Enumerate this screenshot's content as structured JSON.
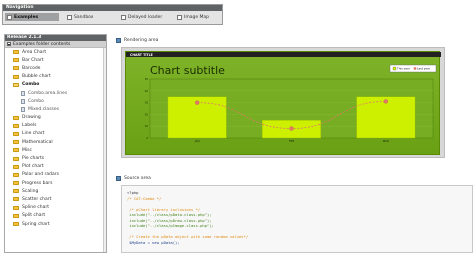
{
  "navigation": {
    "title": "Navigation",
    "tabs": [
      {
        "label": "Examples",
        "active": true
      },
      {
        "label": "Sandbox"
      },
      {
        "label": "Delayed loader"
      },
      {
        "label": "Image Map"
      }
    ]
  },
  "sidebar": {
    "release": "Release 2.1.3",
    "contents_label": "Examples folder contents",
    "items": [
      {
        "label": "Area Chart",
        "kind": "folder"
      },
      {
        "label": "Bar Chart",
        "kind": "folder"
      },
      {
        "label": "Barcode",
        "kind": "folder"
      },
      {
        "label": "Bubble chart",
        "kind": "folder"
      },
      {
        "label": "Combo",
        "kind": "folder-open"
      },
      {
        "label": "Combo.area.lines",
        "kind": "file"
      },
      {
        "label": "Combo",
        "kind": "file"
      },
      {
        "label": "Mixed.classes",
        "kind": "file"
      },
      {
        "label": "Drawing",
        "kind": "folder"
      },
      {
        "label": "Labels",
        "kind": "folder"
      },
      {
        "label": "Line chart",
        "kind": "folder"
      },
      {
        "label": "Mathematical",
        "kind": "folder"
      },
      {
        "label": "Misc",
        "kind": "folder"
      },
      {
        "label": "Pie charts",
        "kind": "folder"
      },
      {
        "label": "Plot chart",
        "kind": "folder"
      },
      {
        "label": "Polar and radars",
        "kind": "folder"
      },
      {
        "label": "Progress bars",
        "kind": "folder"
      },
      {
        "label": "Scaling",
        "kind": "folder"
      },
      {
        "label": "Scatter chart",
        "kind": "folder"
      },
      {
        "label": "Spline chart",
        "kind": "folder"
      },
      {
        "label": "Split chart",
        "kind": "folder"
      },
      {
        "label": "Spring chart",
        "kind": "folder"
      }
    ]
  },
  "rendering": {
    "title": "Rendering area",
    "chart_data": {
      "type": "bar",
      "title": "CHART TITLE",
      "subtitle": "Chart subtitle",
      "categories": [
        "Jan",
        "Feb",
        "Mar"
      ],
      "series": [
        {
          "name": "This year",
          "type": "bar",
          "values": [
            35,
            15,
            35
          ],
          "color": "#ccf000"
        },
        {
          "name": "Last year",
          "type": "line",
          "values": [
            30,
            8,
            31
          ],
          "color": "#e27a6a"
        }
      ],
      "ylim": [
        0,
        50
      ],
      "yticks": [
        0,
        10,
        20,
        30,
        40,
        50
      ],
      "grid": true,
      "legend": "top-right"
    }
  },
  "source": {
    "title": "Source area",
    "lines": [
      {
        "text": "<?php",
        "color": "#333333"
      },
      {
        "text": "/* CAT:Combo */",
        "color": "#e08a12"
      },
      {
        "text": "",
        "color": "#333333"
      },
      {
        "text": " /* pChart library inclusions */",
        "color": "#e08a12"
      },
      {
        "text": " include(\"../class/pData.class.php\");",
        "color": "#3f7f16"
      },
      {
        "text": " include(\"../class/pDraw.class.php\");",
        "color": "#3f7f16"
      },
      {
        "text": " include(\"../class/pImage.class.php\");",
        "color": "#3f7f16"
      },
      {
        "text": "",
        "color": "#333333"
      },
      {
        "text": " /* Create the pData object with some random values*/",
        "color": "#e08a12"
      },
      {
        "text": " $MyData = new pData();",
        "color": "#1d3f8a"
      }
    ]
  }
}
